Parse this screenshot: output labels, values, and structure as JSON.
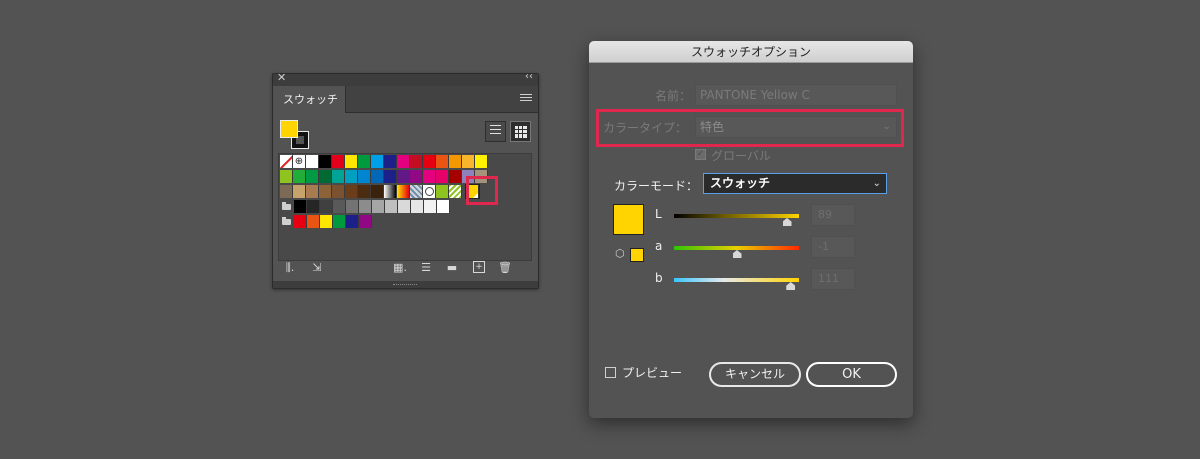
{
  "swatches_panel": {
    "tab_label": "スウォッチ",
    "close_glyph": "✕",
    "collapse_glyph": "‹‹",
    "rows": [
      {
        "folder": false,
        "cells": [
          "none",
          "reg",
          "#ffffff",
          "#000000",
          "#e2001a",
          "#ffe600",
          "#009a3e",
          "#00a0e9",
          "#1d2088",
          "#e4007f",
          "#c30d23",
          "#e60012",
          "#ea5514",
          "#f39800",
          "#f8b62d",
          "#fff100"
        ]
      },
      {
        "folder": false,
        "cells": [
          "#8fc31f",
          "#22ac38",
          "#009944",
          "#006934",
          "#00a497",
          "#00a0c1",
          "#0086d1",
          "#0068b7",
          "#1d2088",
          "#601986",
          "#920783",
          "#e4007f",
          "#e5006a",
          "#a40000",
          "#8f82bc",
          "#a6937c"
        ]
      },
      {
        "folder": false,
        "cells": [
          "#7c6a55",
          "#c7a26a",
          "#a97b50",
          "#8c6239",
          "#7b5230",
          "#6a3e1b",
          "#4b2c10",
          "#3a220c",
          "gradient-bw",
          "gradient-orange",
          "pattern",
          "circle",
          "#8fc31f",
          "pattern2",
          "spot"
        ]
      },
      {
        "folder": true,
        "cells": [
          "#000000",
          "#262626",
          "#404040",
          "#595959",
          "#737373",
          "#8c8c8c",
          "#a6a6a6",
          "#bfbfbf",
          "#d9d9d9",
          "#e6e6e6",
          "#f2f2f2",
          "#ffffff"
        ]
      },
      {
        "folder": true,
        "cells": [
          "#e60012",
          "#ea5514",
          "#ffe600",
          "#009a3e",
          "#1d2088",
          "#920783"
        ]
      }
    ]
  },
  "dialog": {
    "title": "スウォッチオプション",
    "name_label": "名前：",
    "name_value": "PANTONE Yellow C",
    "color_type_label": "カラータイプ：",
    "color_type_value": "特色",
    "global_label": "グローバル",
    "global_checked": true,
    "color_mode_label": "カラーモード：",
    "color_mode_value": "スウォッチ",
    "swatch_color": "#ffd400",
    "sliders": [
      {
        "label": "L",
        "value": "89",
        "position": 0.9
      },
      {
        "label": "a",
        "value": "-1",
        "position": 0.5
      },
      {
        "label": "b",
        "value": "111",
        "position": 0.93
      }
    ],
    "preview_label": "プレビュー",
    "preview_checked": false,
    "cancel_label": "キャンセル",
    "ok_label": "OK"
  },
  "colors": {
    "highlight": "#e0284f",
    "spot_yellow": "#ffd400",
    "focus_blue": "#5aa0e6"
  }
}
